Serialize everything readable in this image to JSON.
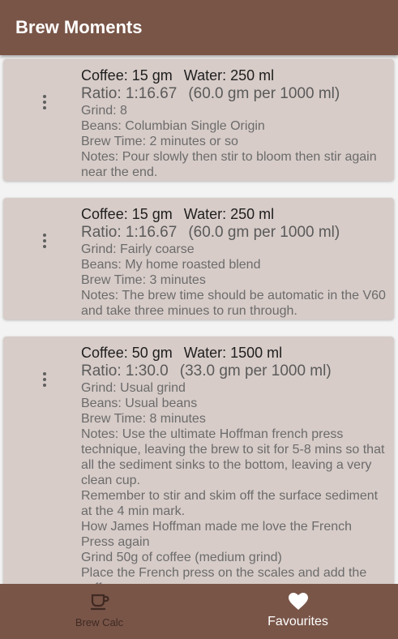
{
  "appbar": {
    "title": "Brew Moments"
  },
  "brews": [
    {
      "coffee": "Coffee: 15 gm",
      "water": "Water: 250 ml",
      "ratio": "Ratio: 1:16.67",
      "ratio_per": "(60.0 gm per 1000 ml)",
      "lines": [
        "Grind: 8",
        "Beans: Columbian Single Origin",
        "Brew Time: 2 minutes or so",
        "Notes: Pour slowly then stir to bloom then stir again near the end."
      ]
    },
    {
      "coffee": "Coffee: 15 gm",
      "water": "Water: 250 ml",
      "ratio": "Ratio: 1:16.67",
      "ratio_per": "(60.0 gm per 1000 ml)",
      "lines": [
        "Grind: Fairly coarse",
        "Beans: My home roasted blend",
        "Brew Time: 3 minutes",
        "Notes: The brew time should be automatic in the V60 and take three minues to run through."
      ]
    },
    {
      "coffee": "Coffee: 50 gm",
      "water": "Water: 1500 ml",
      "ratio": "Ratio: 1:30.0",
      "ratio_per": "(33.0 gm per 1000 ml)",
      "lines": [
        "Grind: Usual grind",
        "Beans: Usual beans",
        "Brew Time: 8 minutes",
        "Notes: Use the ultimate Hoffman french press technique, leaving the brew to sit for 5-8 mins so that all the sediment sinks to the bottom, leaving a very clean cup.",
        "Remember to stir and skim off the surface sediment at the 4 min mark.",
        "How James Hoffman made me love the French Press again",
        "Grind 50g of coffee (medium grind)",
        "Place the French press on the scales and add the coffee"
      ]
    }
  ],
  "bottom_nav": [
    {
      "label": "Brew Calc",
      "icon": "cup-icon",
      "active": false
    },
    {
      "label": "Favourites",
      "icon": "heart-icon",
      "active": true
    }
  ],
  "colors": {
    "primary": "#795548",
    "card": "#d7ccc8",
    "inactive_nav": "#3f2a22"
  }
}
